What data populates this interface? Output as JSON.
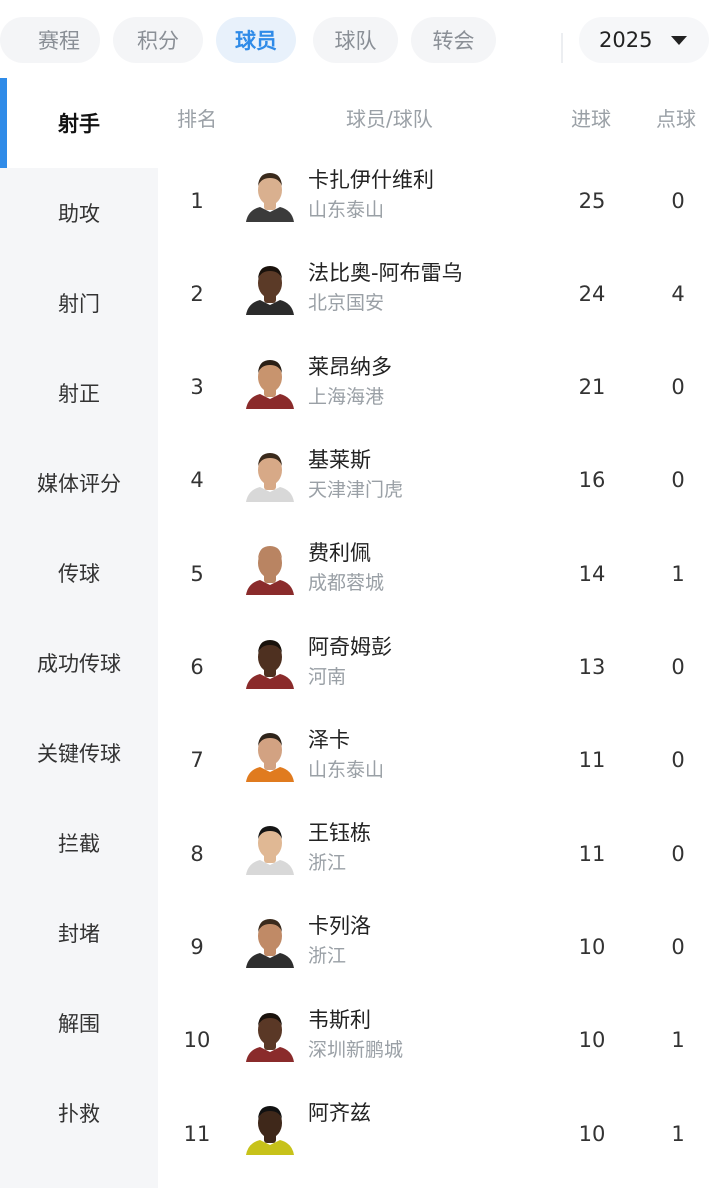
{
  "tabs": [
    "赛程",
    "积分",
    "球员",
    "球队",
    "转会"
  ],
  "active_tab": "球员",
  "year": "2025",
  "sidebar": [
    "射手",
    "助攻",
    "射门",
    "射正",
    "媒体评分",
    "传球",
    "成功传球",
    "关键传球",
    "拦截",
    "封堵",
    "解围",
    "扑救"
  ],
  "table": {
    "headers": {
      "rank": "排名",
      "player": "球员/球队",
      "goals": "进球",
      "penalties": "点球"
    },
    "rows": [
      {
        "rank": "1",
        "name": "卡扎伊什维利",
        "team": "山东泰山",
        "goals": "25",
        "penalties": "0"
      },
      {
        "rank": "2",
        "name": "法比奥-阿布雷乌",
        "team": "北京国安",
        "goals": "24",
        "penalties": "4"
      },
      {
        "rank": "3",
        "name": "莱昂纳多",
        "team": "上海海港",
        "goals": "21",
        "penalties": "0"
      },
      {
        "rank": "4",
        "name": "基莱斯",
        "team": "天津津门虎",
        "goals": "16",
        "penalties": "0"
      },
      {
        "rank": "5",
        "name": "费利佩",
        "team": "成都蓉城",
        "goals": "14",
        "penalties": "1"
      },
      {
        "rank": "6",
        "name": "阿奇姆彭",
        "team": "河南",
        "goals": "13",
        "penalties": "0"
      },
      {
        "rank": "7",
        "name": "泽卡",
        "team": "山东泰山",
        "goals": "11",
        "penalties": "0"
      },
      {
        "rank": "8",
        "name": "王钰栋",
        "team": "浙江",
        "goals": "11",
        "penalties": "0"
      },
      {
        "rank": "9",
        "name": "卡列洛",
        "team": "浙江",
        "goals": "10",
        "penalties": "0"
      },
      {
        "rank": "10",
        "name": "韦斯利",
        "team": "深圳新鹏城",
        "goals": "10",
        "penalties": "1"
      },
      {
        "rank": "11",
        "name": "阿齐兹",
        "team": "",
        "goals": "10",
        "penalties": "1"
      }
    ]
  },
  "colors": {
    "accent": "#2f8be8",
    "active_tab_bg": "#e8f1fb",
    "sidebar_bg": "#f5f6f8",
    "muted_text": "#9aa0a6"
  },
  "icons": {
    "year_dropdown": "caret-down-icon",
    "player_photo": "player-avatar-icon"
  }
}
